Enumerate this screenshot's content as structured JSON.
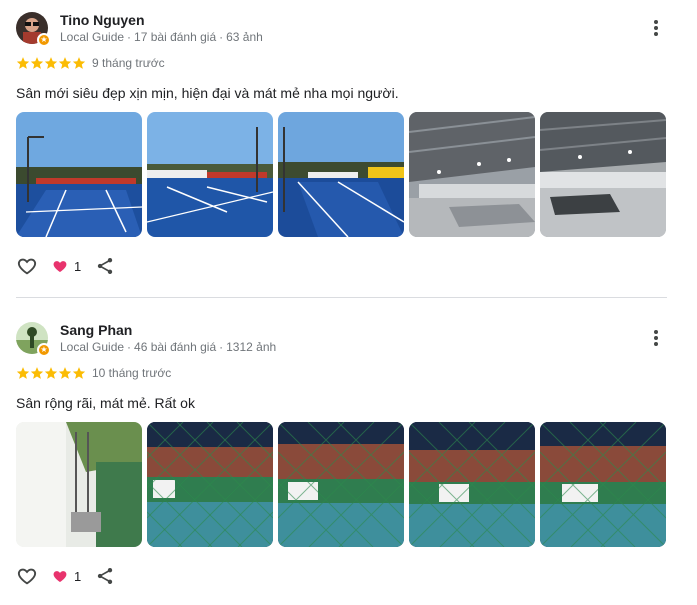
{
  "reviews": [
    {
      "author": "Tino Nguyen",
      "badge": "Local Guide",
      "reviews_count": "17 bài đánh giá",
      "photos_count": "63 ảnh",
      "rating": 5,
      "time": "9 tháng trước",
      "text": "Sân mới siêu đẹp xịn mịn, hiện đại và mát mẻ nha mọi người.",
      "photos": [
        "outdoor-court-photo",
        "outdoor-court-photo",
        "outdoor-court-photo",
        "indoor-court-photo",
        "indoor-court-photo"
      ],
      "reactions": "1"
    },
    {
      "author": "Sang Phan",
      "badge": "Local Guide",
      "reviews_count": "46 bài đánh giá",
      "photos_count": "1312 ảnh",
      "rating": 5,
      "time": "10 tháng trước",
      "text": "Sân rộng rãi, mát mẻ. Rất ok",
      "photos": [
        "corridor-photo",
        "fenced-court-photo",
        "fenced-court-photo",
        "fenced-court-photo",
        "fenced-court-photo"
      ],
      "reactions": "1"
    }
  ],
  "icons": {
    "more": "more-vert-icon",
    "like": "heart-outline-icon",
    "reaction": "heart-filled-icon",
    "share": "share-icon",
    "star": "star-icon"
  },
  "colors": {
    "star": "#fbbc04",
    "reaction_heart": "#e8336d",
    "secondary_text": "#70757a",
    "divider": "#dadce0"
  }
}
